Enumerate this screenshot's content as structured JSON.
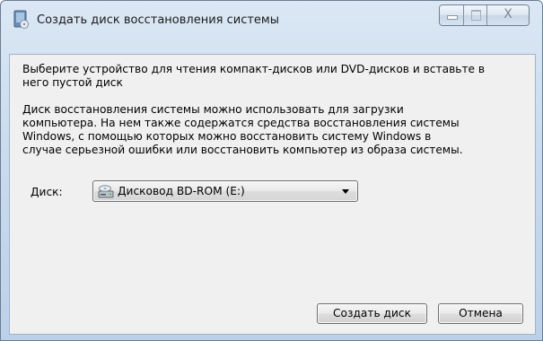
{
  "window": {
    "title": "Создать диск восстановления системы",
    "close_glyph": "X"
  },
  "content": {
    "instruction": "Выберите устройство для чтения компакт-дисков или DVD-дисков и вставьте в него пустой диск",
    "instruction_lines": [
      "Выберите устройство для чтения компакт-дисков или DVD-дисков и вставьте в",
      "него пустой диск"
    ],
    "description_lines": [
      "Диск восстановления системы можно использовать для загрузки",
      "компьютера. На нем также содержатся средства восстановления системы",
      "Windows, с помощью которых можно восстановить систему Windows в",
      "случае серьезной ошибки или восстановить компьютер из образа системы."
    ],
    "disk_label": "Диск:",
    "disk_selected": "Дисковод BD-ROM (E:)",
    "drive_icon": "optical-drive-icon"
  },
  "buttons": {
    "create": "Создать диск",
    "cancel": "Отмена"
  },
  "colors": {
    "frame": "#c9dbee",
    "client": "#f0f0f0"
  }
}
